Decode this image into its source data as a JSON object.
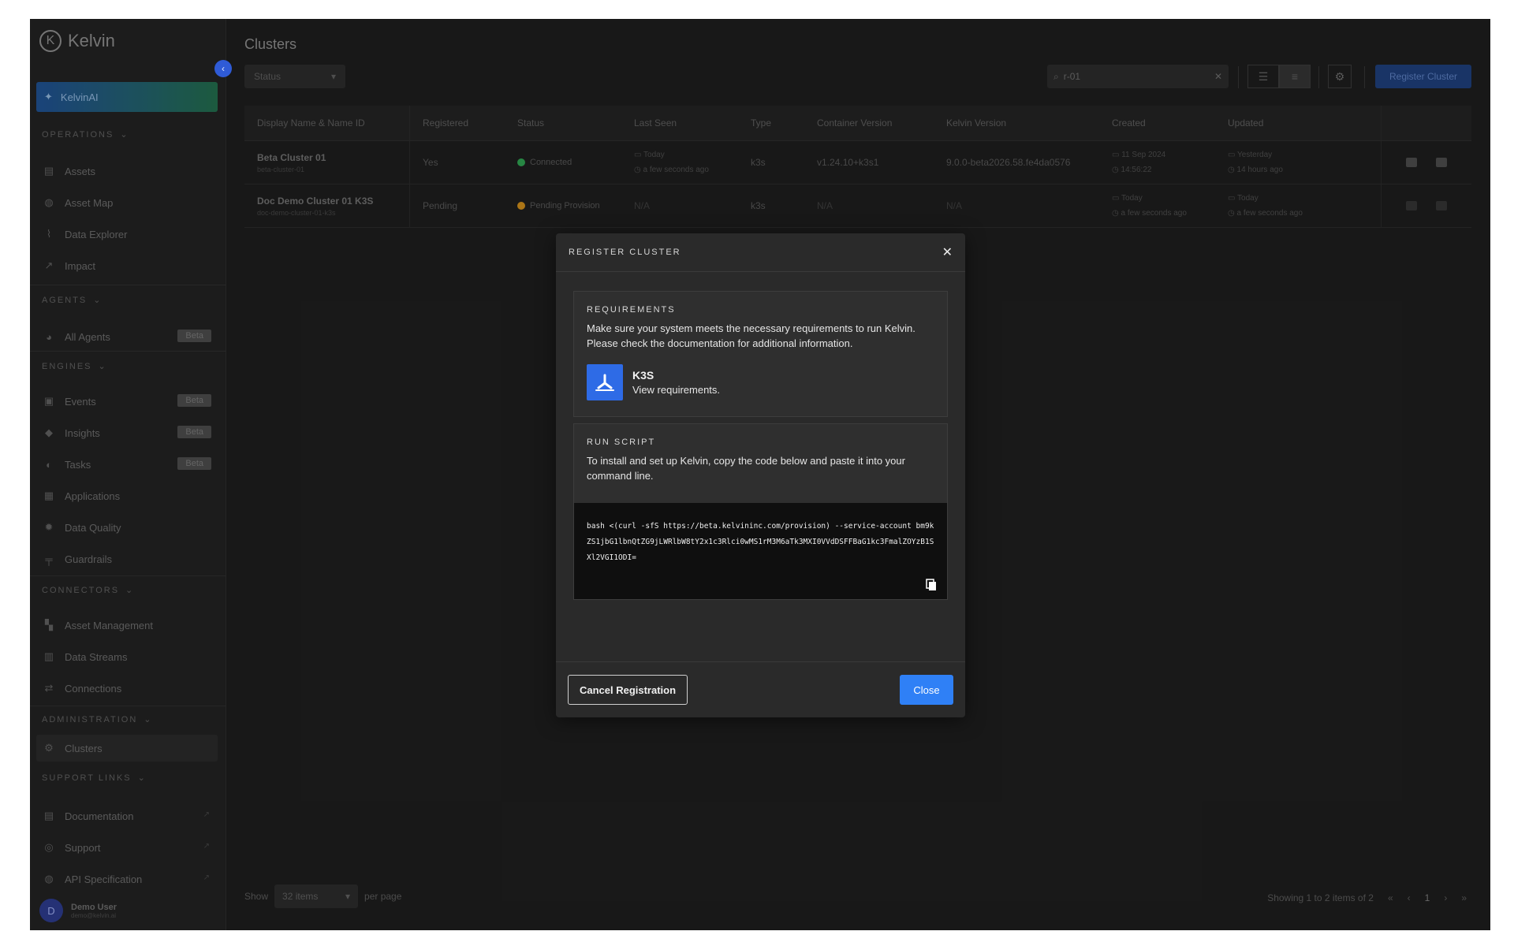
{
  "sidebar": {
    "logo_text": "Kelvin",
    "ai_label": "KelvinAI",
    "sections": {
      "operations": "OPERATIONS",
      "agents": "AGENTS",
      "engines": "ENGINES",
      "connectors": "CONNECTORS",
      "administration": "ADMINISTRATION",
      "support": "SUPPORT LINKS"
    },
    "items": {
      "assets": "Assets",
      "asset_map": "Asset Map",
      "data_explorer": "Data Explorer",
      "impact": "Impact",
      "all_agents": "All Agents",
      "events": "Events",
      "insights": "Insights",
      "tasks": "Tasks",
      "applications": "Applications",
      "data_quality": "Data Quality",
      "guardrails": "Guardrails",
      "asset_management": "Asset Management",
      "data_streams": "Data Streams",
      "connections": "Connections",
      "clusters": "Clusters",
      "documentation": "Documentation",
      "support": "Support",
      "api_spec": "API Specification"
    },
    "beta_label": "Beta",
    "user": {
      "name": "Demo User",
      "email": "demo@kelvin.ai",
      "initial": "D"
    }
  },
  "main": {
    "title": "Clusters",
    "status_filter": "Status",
    "search_value": "r-01",
    "register_button": "Register Cluster",
    "columns": [
      "Display Name & Name ID",
      "Registered",
      "Status",
      "Last Seen",
      "Type",
      "Container Version",
      "Kelvin Version",
      "Created",
      "Updated"
    ],
    "rows": [
      {
        "name": "Beta Cluster 01",
        "id": "beta-cluster-01",
        "registered": "Yes",
        "status": "Connected",
        "status_color": "#2e9e4f",
        "last_seen_date": "Today",
        "last_seen_time": "a few seconds ago",
        "type": "k3s",
        "container_version": "v1.24.10+k3s1",
        "kelvin_version": "9.0.0-beta2026.58.fe4da0576",
        "created_date": "11 Sep 2024",
        "created_time": "14:56:22",
        "updated_date": "Yesterday",
        "updated_time": "14 hours ago"
      },
      {
        "name": "Doc Demo Cluster 01 K3S",
        "id": "doc-demo-cluster-01-k3s",
        "registered": "Pending",
        "status": "Pending Provision",
        "status_color": "#c98a1a",
        "last_seen": "N/A",
        "type": "k3s",
        "container_version": "N/A",
        "kelvin_version": "N/A",
        "created_date": "Today",
        "created_time": "a few seconds ago",
        "updated_date": "Today",
        "updated_time": "a few seconds ago"
      }
    ],
    "pager": {
      "show": "Show",
      "per_page_value": "32 items",
      "per_page": "per page",
      "summary": "Showing 1 to 2 items of 2",
      "current_page": "1"
    }
  },
  "modal": {
    "title": "REGISTER CLUSTER",
    "requirements_title": "REQUIREMENTS",
    "requirements_text": "Make sure your system meets the necessary requirements to run Kelvin. Please check the documentation for additional information.",
    "k3s_name": "K3S",
    "k3s_link": "View requirements.",
    "script_title": "RUN SCRIPT",
    "script_text": "To install and set up Kelvin, copy the code below and paste it into your command line.",
    "code": "bash <(curl -sfS https://beta.kelvininc.com/provision) --service-account bm9kZS1jbG1lbnQtZG9jLWRlbW8tY2x1c3Rlci0wMS1rM3M6aTk3MXI0VVdDSFFBaG1kc3FmalZOYzB1SXl2VGI1ODI=",
    "cancel_button": "Cancel Registration",
    "close_button": "Close"
  }
}
